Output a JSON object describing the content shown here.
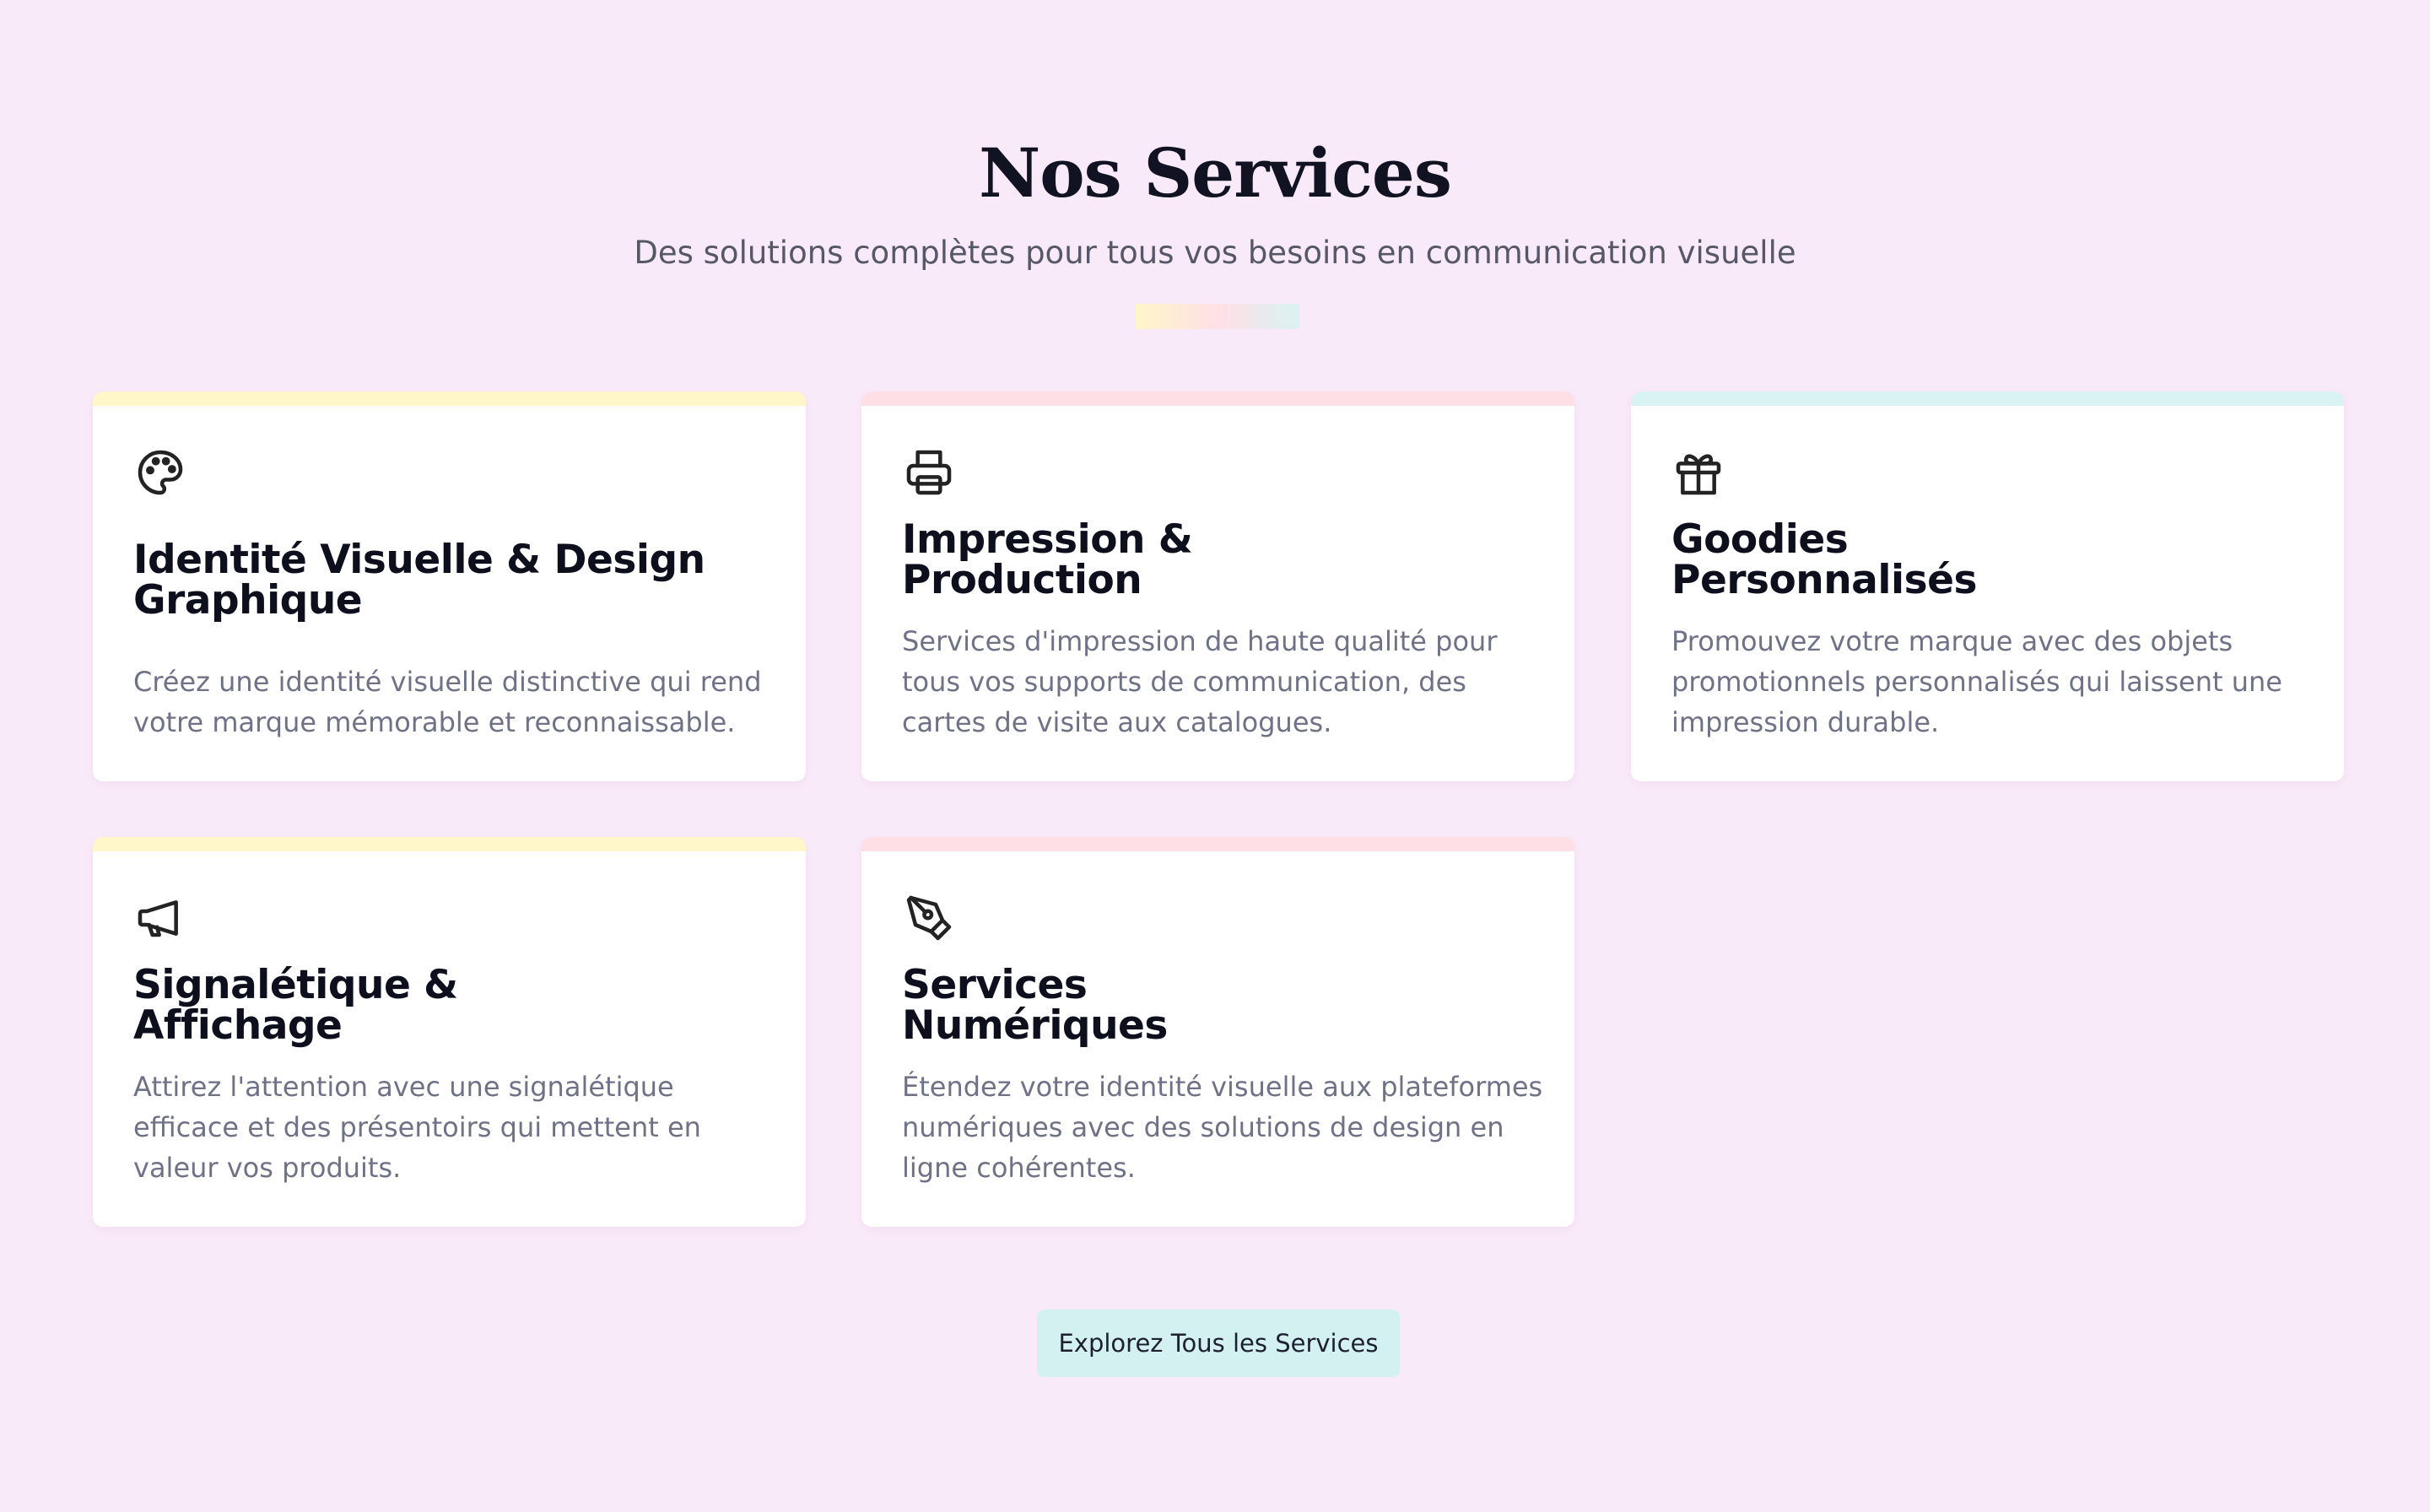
{
  "header": {
    "title": "Nos Services",
    "subtitle": "Des solutions complètes pour tous vos besoins en communication visuelle"
  },
  "colors": {
    "background": "#f9eaf9",
    "accent_yellow": "#fff6c9",
    "accent_pink": "#ffdfe6",
    "accent_cyan": "#d9f2f2"
  },
  "cards": [
    {
      "icon": "palette-icon",
      "accent": "#fff6c9",
      "title_line1": "Identité Visuelle & Design",
      "title_line2": "Graphique",
      "description": "Créez une identité visuelle distinctive qui rend votre marque mémorable et reconnaissable."
    },
    {
      "icon": "printer-icon",
      "accent": "#ffdfe6",
      "title_line1": "Impression &",
      "title_line2": "Production",
      "description": "Services d'impression de haute qualité pour tous vos supports de communication, des cartes de visite aux catalogues."
    },
    {
      "icon": "gift-icon",
      "accent": "#d9f2f2",
      "title_line1": "Goodies",
      "title_line2": "Personnalisés",
      "description": "Promouvez votre marque avec des objets promotionnels personnalisés qui laissent une impression durable."
    },
    {
      "icon": "megaphone-icon",
      "accent": "#fff6c9",
      "title_line1": "Signalétique &",
      "title_line2": "Affichage",
      "description": "Attirez l'attention avec une signalétique efficace et des présentoirs qui mettent en valeur vos produits."
    },
    {
      "icon": "pen-tool-icon",
      "accent": "#ffdfe6",
      "title_line1": "Services",
      "title_line2": "Numériques",
      "description": "Étendez votre identité visuelle aux plateformes numériques avec des solutions de design en ligne cohérentes."
    }
  ],
  "cta": {
    "label": "Explorez Tous les Services"
  }
}
